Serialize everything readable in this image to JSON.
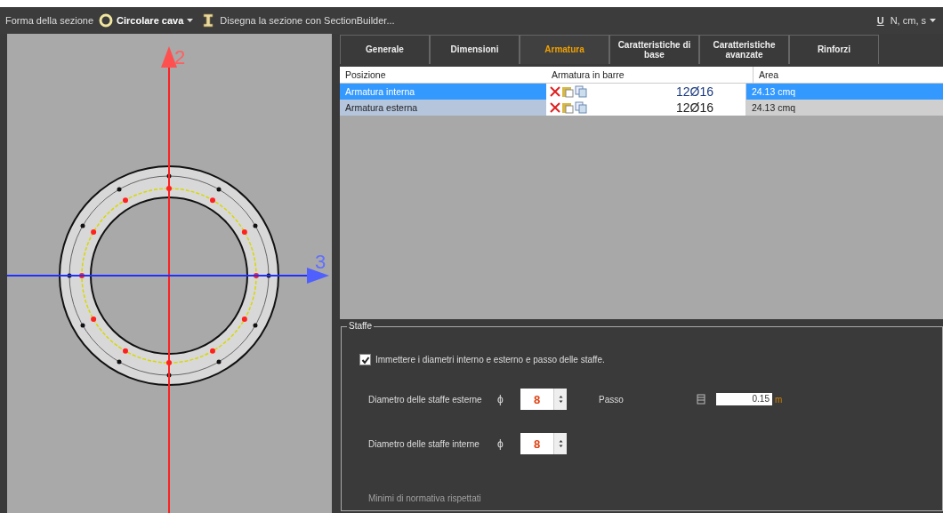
{
  "toolbar": {
    "shape_label": "Forma della sezione",
    "shape_value": "Circolare cava",
    "builder_link": "Disegna la sezione con SectionBuilder...",
    "unit_letter": "U",
    "units": "N, cm, s"
  },
  "section_view": {
    "axis_vertical_label": "2",
    "axis_horizontal_label": "3"
  },
  "tabs": [
    {
      "label": "Generale",
      "selected": false
    },
    {
      "label": "Dimensioni",
      "selected": false
    },
    {
      "label": "Armatura",
      "selected": true
    },
    {
      "label": "Caratteristiche di base",
      "selected": false
    },
    {
      "label": "Caratteristiche avanzate",
      "selected": false
    },
    {
      "label": "Rinforzi",
      "selected": false
    }
  ],
  "table": {
    "columns": [
      "Posizione",
      "Armatura in barre",
      "Area"
    ],
    "rows": [
      {
        "position": "Armatura interna",
        "bars": "12Ø16",
        "area": "24.13 cmq",
        "selected": true
      },
      {
        "position": "Armatura esterna",
        "bars": "12Ø16",
        "area": "24.13 cmq",
        "selected": false
      }
    ]
  },
  "stirrups": {
    "title": "Staffe",
    "option": {
      "label": "Immettere i diametri interno e esterno e passo delle staffe.",
      "checked": true
    },
    "outer": {
      "label": "Diametro delle staffe esterne",
      "symbol": "ϕ",
      "value": "8"
    },
    "pitch": {
      "label": "Passo",
      "value": "0.15",
      "unit": "m"
    },
    "inner": {
      "label": "Diametro delle staffe interne",
      "symbol": "ϕ",
      "value": "8"
    },
    "status": "Minimi di normativa rispettati"
  }
}
